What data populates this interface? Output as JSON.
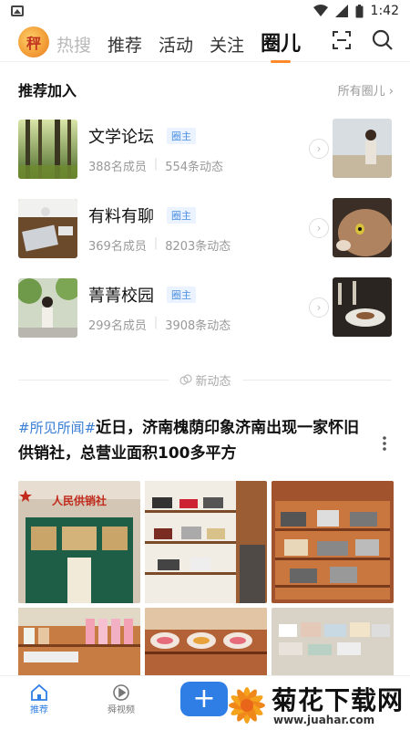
{
  "status_bar": {
    "time": "1:42"
  },
  "top_nav": {
    "logo_text": "秤",
    "tabs": [
      {
        "label": "热搜"
      },
      {
        "label": "推荐"
      },
      {
        "label": "活动"
      },
      {
        "label": "关注"
      },
      {
        "label": "圈儿"
      }
    ],
    "active_tab": "圈儿"
  },
  "recommended": {
    "title": "推荐加入",
    "more_label": "所有圈儿",
    "rows": [
      {
        "name": "文学论坛",
        "badge": "圈主",
        "members": "388名成员",
        "posts": "554条动态"
      },
      {
        "name": "有料有聊",
        "badge": "圈主",
        "members": "369名成员",
        "posts": "8203条动态"
      },
      {
        "name": "菁菁校园",
        "badge": "圈主",
        "members": "299名成员",
        "posts": "3908条动态"
      }
    ]
  },
  "divider_label": "新动态",
  "post": {
    "tag": "#所见所闻#",
    "title": "近日，济南槐荫印象济南出现一家怀旧供销社，总营业面积100多平方",
    "sign_text": "人民供销社"
  },
  "bottom_bar": {
    "items": [
      {
        "label": "推荐"
      },
      {
        "label": "舜视频"
      }
    ],
    "plus_label": "+"
  },
  "watermark": {
    "title": "菊花下载网",
    "url": "www.juahar.com"
  },
  "colors": {
    "accent": "#ff8a2b",
    "primary_blue": "#2f7ee6",
    "tag_blue": "#3a7fd4"
  }
}
